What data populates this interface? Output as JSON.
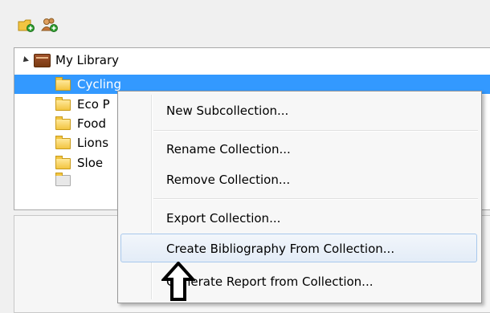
{
  "toolbar": {
    "new_collection_icon": "folder-add-icon",
    "new_group_icon": "group-add-icon"
  },
  "tree": {
    "root": {
      "label": "My Library",
      "icon": "library-icon"
    },
    "items": [
      {
        "label": "Cycling",
        "selected": true
      },
      {
        "label": "Eco P"
      },
      {
        "label": "Food"
      },
      {
        "label": "Lions"
      },
      {
        "label": "Sloe"
      }
    ]
  },
  "context_menu": {
    "items": [
      {
        "label": "New Subcollection..."
      },
      {
        "label": "Rename Collection..."
      },
      {
        "label": "Remove Collection..."
      },
      {
        "label": "Export Collection..."
      },
      {
        "label": "Create Bibliography From Collection...",
        "highlighted": true
      },
      {
        "label": "Generate Report from Collection..."
      }
    ]
  },
  "colors": {
    "selection": "#3399ff",
    "menu_hover_border": "#a8c8ec",
    "menu_background": "#f7f7f7"
  },
  "cursor_icon": "arrow-up-cursor-icon"
}
